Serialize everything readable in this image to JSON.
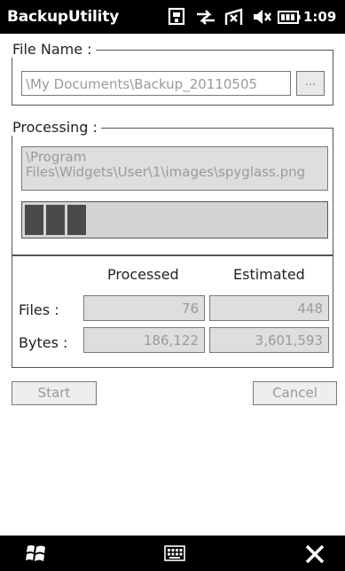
{
  "app": {
    "title": "BackupUtility"
  },
  "status_bar": {
    "time": "1:09",
    "icons": [
      "sim-icon",
      "data-sync-icon",
      "no-signal-icon",
      "volume-muted-icon",
      "battery-icon"
    ]
  },
  "file_name": {
    "label": "File Name :",
    "value": "\\My Documents\\Backup_20110505",
    "browse_label": "..."
  },
  "processing": {
    "label": "Processing :",
    "current_file": "\\Program Files\\Widgets\\User\\1\\images\\spyglass.png",
    "progress_blocks": 3
  },
  "stats": {
    "col_processed": "Processed",
    "col_estimated": "Estimated",
    "rows": [
      {
        "label": "Files :",
        "processed": "76",
        "estimated": "448"
      },
      {
        "label": "Bytes :",
        "processed": "186,122",
        "estimated": "3,601,593"
      }
    ]
  },
  "actions": {
    "start_label": "Start",
    "cancel_label": "Cancel"
  },
  "bottom_bar": {
    "icons": [
      "windows-start-icon",
      "keyboard-icon",
      "close-icon"
    ]
  },
  "colors": {
    "bar_background": "#000000",
    "disabled_text": "#9a9a9a",
    "progress_fill": "#4a4a4a"
  }
}
